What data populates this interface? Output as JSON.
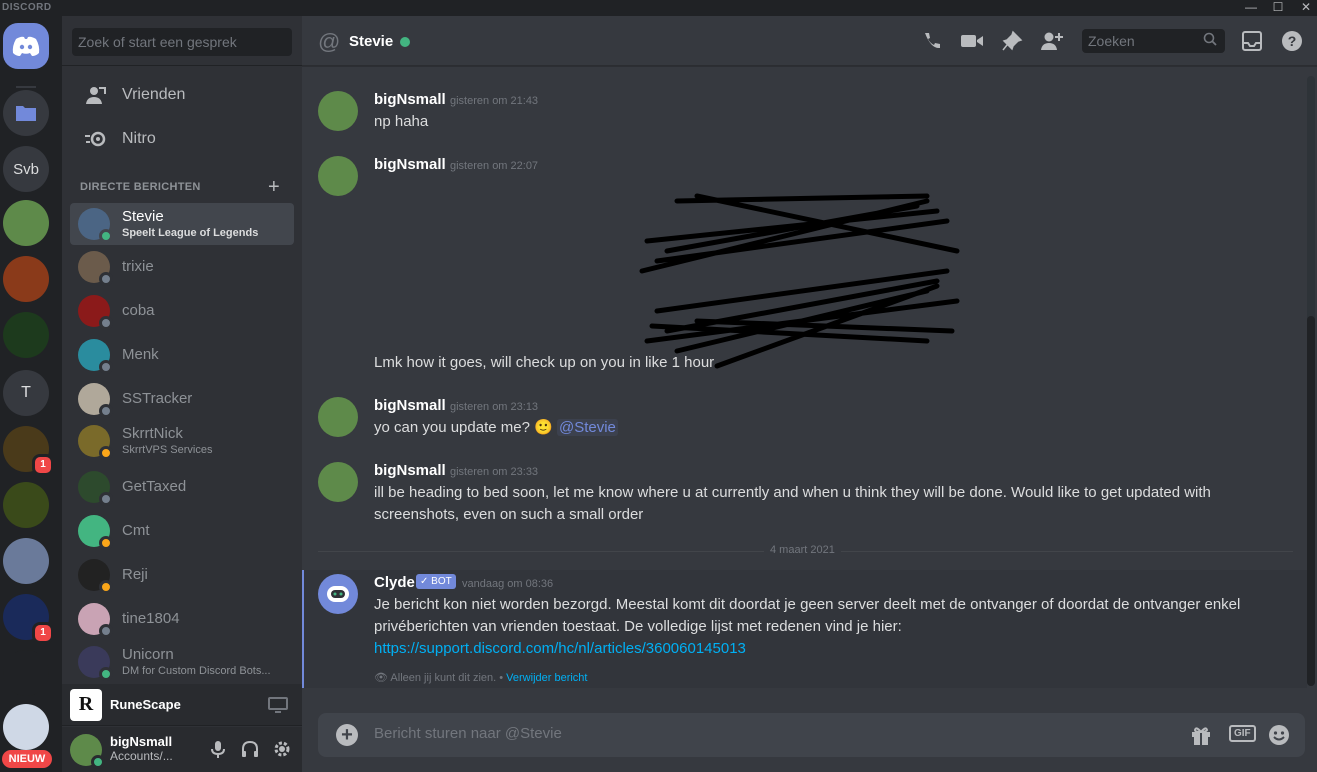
{
  "window": {
    "brand": "DISCORD",
    "min": "—",
    "max": "☐",
    "close": "✕"
  },
  "rail": {
    "servers": [
      {
        "initials": "Svb"
      },
      {
        "initials": "T"
      }
    ],
    "badge_count_1": "1",
    "badge_count_2": "1",
    "new_label": "NIEUW"
  },
  "sidebar": {
    "search_placeholder": "Zoek of start een gesprek",
    "nav": [
      {
        "label": "Vrienden",
        "icon": "friends-icon"
      },
      {
        "label": "Nitro",
        "icon": "nitro-icon"
      }
    ],
    "dm_header": "DIRECTE BERICHTEN",
    "dms": [
      {
        "name": "Stevie",
        "sub_prefix": "Speelt ",
        "sub_game": "League of Legends",
        "status": "on",
        "color": "#4b6584",
        "active": true
      },
      {
        "name": "trixie",
        "sub": "",
        "status": "off",
        "color": "#6b5b4b"
      },
      {
        "name": "coba",
        "sub": "",
        "status": "off",
        "color": "#8b1a1a"
      },
      {
        "name": "Menk",
        "sub": "",
        "status": "off",
        "color": "#2a8c9e"
      },
      {
        "name": "SSTracker",
        "sub": "",
        "status": "off",
        "color": "#b0a89a"
      },
      {
        "name": "SkrrtNick",
        "sub": "SkrrtVPS Services",
        "status": "idle",
        "color": "#7a6a2a"
      },
      {
        "name": "GetTaxed",
        "sub": "",
        "status": "off",
        "color": "#2d4a2d"
      },
      {
        "name": "Cmt",
        "sub": "",
        "status": "idle",
        "color": "#43b581"
      },
      {
        "name": "Reji",
        "sub": "",
        "status": "idle",
        "color": "#222222"
      },
      {
        "name": "tine1804",
        "sub": "",
        "status": "off",
        "color": "#c9a3b4"
      },
      {
        "name": "Unicorn",
        "sub": "DM for Custom Discord Bots...",
        "status": "on",
        "color": "#3a3a5a"
      }
    ],
    "playing": {
      "game": "RuneScape",
      "logo": "R"
    },
    "user": {
      "name": "bigNsmall",
      "status": "Accounts/..."
    }
  },
  "chat": {
    "at_symbol": "@",
    "title": "Stevie",
    "search_placeholder": "Zoeken",
    "messages": [
      {
        "author": "bigNsmall",
        "time": "gisteren om 21:43",
        "lines": [
          "np haha"
        ]
      },
      {
        "author": "bigNsmall",
        "time": "gisteren om 22:07",
        "lines": [
          "Lmk how it goes, will check up on you in like 1 hour"
        ]
      },
      {
        "author": "bigNsmall",
        "time": "gisteren om 23:13",
        "text": "yo can you update me? ",
        "emoji": "🙂",
        "mention": "@Stevie"
      },
      {
        "author": "bigNsmall",
        "time": "gisteren om 23:33",
        "lines": [
          "ill be heading to bed soon, let me know where u at currently and when u think they will be done. Would like to get updated with",
          "screenshots, even on such a small order"
        ]
      }
    ],
    "divider": "4 maart 2021",
    "clyde": {
      "author": "Clyde",
      "badge": "✓ BOT",
      "time": "vandaag om 08:36",
      "line1": "Je bericht kon niet worden bezorgd. Meestal komt dit doordat je geen server deelt met de ontvanger of doordat de ontvanger enkel",
      "line2": "privéberichten van vrienden toestaat. De volledige lijst met redenen vind je hier:",
      "link": "https://support.discord.com/hc/nl/articles/360060145013",
      "only_you": "Alleen jij kunt dit zien. • ",
      "delete": "Verwijder bericht"
    },
    "composer_placeholder": "Bericht sturen naar @Stevie",
    "gif_label": "GIF"
  },
  "colors": {
    "accent": "#7289da",
    "online": "#43b581",
    "idle": "#faa61a",
    "danger": "#f04747",
    "link": "#00b0f4"
  }
}
